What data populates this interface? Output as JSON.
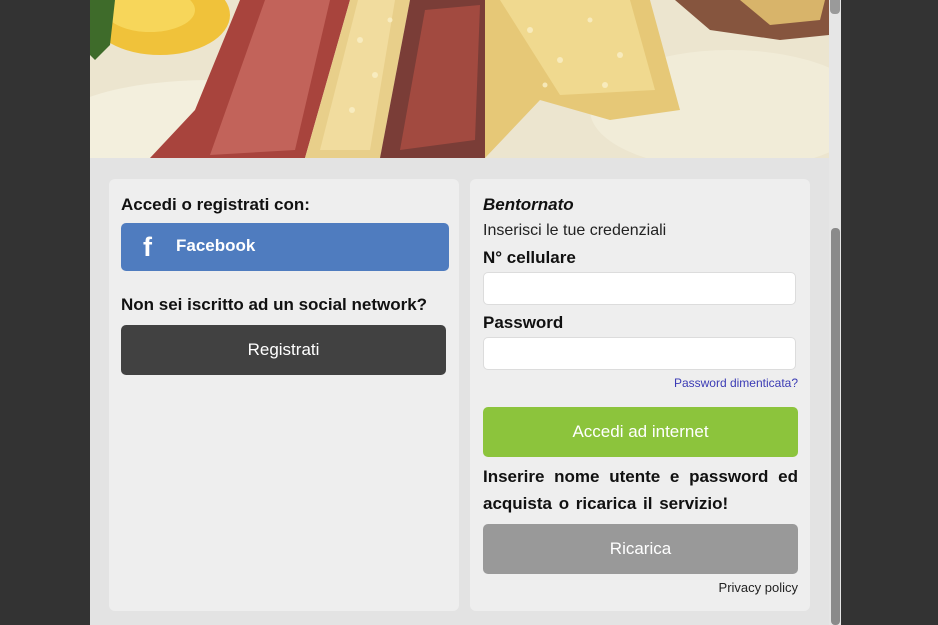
{
  "left_panel": {
    "social_heading": "Accedi o registrati con:",
    "facebook_icon": "f",
    "facebook_label": "Facebook",
    "no_social_heading": "Non sei iscritto ad un social network?",
    "register_label": "Registrati"
  },
  "right_panel": {
    "welcome": "Bentornato",
    "subtitle": "Inserisci le tue credenziali",
    "phone_label": "N° cellulare",
    "phone_value": "",
    "password_label": "Password",
    "password_value": "",
    "forgot_password": "Password dimenticata?",
    "login_label": "Accedi ad internet",
    "info_text": "Inserire nome utente e password ed acquista o ricarica il servizio!",
    "recharge_label": "Ricarica",
    "privacy_label": "Privacy policy"
  },
  "colors": {
    "facebook": "#4f7cbf",
    "register": "#414141",
    "login": "#8cc43c",
    "recharge": "#999999",
    "background": "#333333"
  },
  "icons": {
    "facebook": "facebook-icon"
  }
}
